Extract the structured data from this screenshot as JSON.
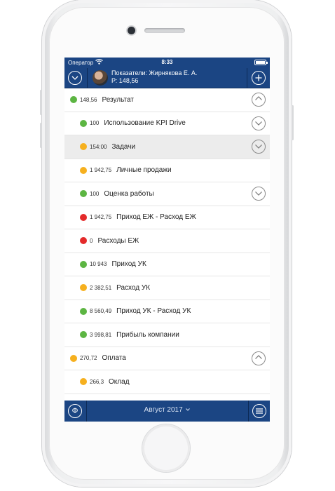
{
  "status": {
    "carrier": "Оператор",
    "time": "8:33",
    "battery_level": 1.0
  },
  "header": {
    "title": "Показатели: Жирнякова Е. А.",
    "subtitle": "Р: 148,56"
  },
  "colors": {
    "brand": "#1b4583",
    "green": "#5cb542",
    "orange": "#f6b01e",
    "red": "#e42a2a",
    "selected_row": "#ececec"
  },
  "items": [
    {
      "value": "148,56",
      "label": "Результат",
      "status": "green",
      "level": 0,
      "chevron": "up",
      "selected": false
    },
    {
      "value": "100",
      "label": "Использование KPI Drive",
      "status": "green",
      "level": 1,
      "chevron": "down",
      "selected": false
    },
    {
      "value": "154:00",
      "label": "Задачи",
      "status": "orange",
      "level": 1,
      "chevron": "down",
      "selected": true
    },
    {
      "value": "1 942,75",
      "label": "Личные продажи",
      "status": "orange",
      "level": 1,
      "chevron": "",
      "selected": false
    },
    {
      "value": "100",
      "label": "Оценка работы",
      "status": "green",
      "level": 1,
      "chevron": "down",
      "selected": false
    },
    {
      "value": "1 942,75",
      "label": "Приход ЕЖ - Расход ЕЖ",
      "status": "red",
      "level": 1,
      "chevron": "",
      "selected": false
    },
    {
      "value": "0",
      "label": "Расходы ЕЖ",
      "status": "red",
      "level": 1,
      "chevron": "",
      "selected": false
    },
    {
      "value": "10 943",
      "label": "Приход УК",
      "status": "green",
      "level": 1,
      "chevron": "",
      "selected": false
    },
    {
      "value": "2 382,51",
      "label": "Расход УК",
      "status": "orange",
      "level": 1,
      "chevron": "",
      "selected": false
    },
    {
      "value": "8 560,49",
      "label": "Приход УК - Расход УК",
      "status": "green",
      "level": 1,
      "chevron": "",
      "selected": false
    },
    {
      "value": "3 998,81",
      "label": "Прибыль компании",
      "status": "green",
      "level": 1,
      "chevron": "",
      "selected": false
    },
    {
      "value": "270,72",
      "label": "Оплата",
      "status": "orange",
      "level": 0,
      "chevron": "up",
      "selected": false
    },
    {
      "value": "266,3",
      "label": "Оклад",
      "status": "orange",
      "level": 1,
      "chevron": "",
      "selected": false
    }
  ],
  "tabbar": {
    "period": "Август 2017",
    "left_icon": "phi-icon",
    "right_icon": "menu-icon"
  }
}
